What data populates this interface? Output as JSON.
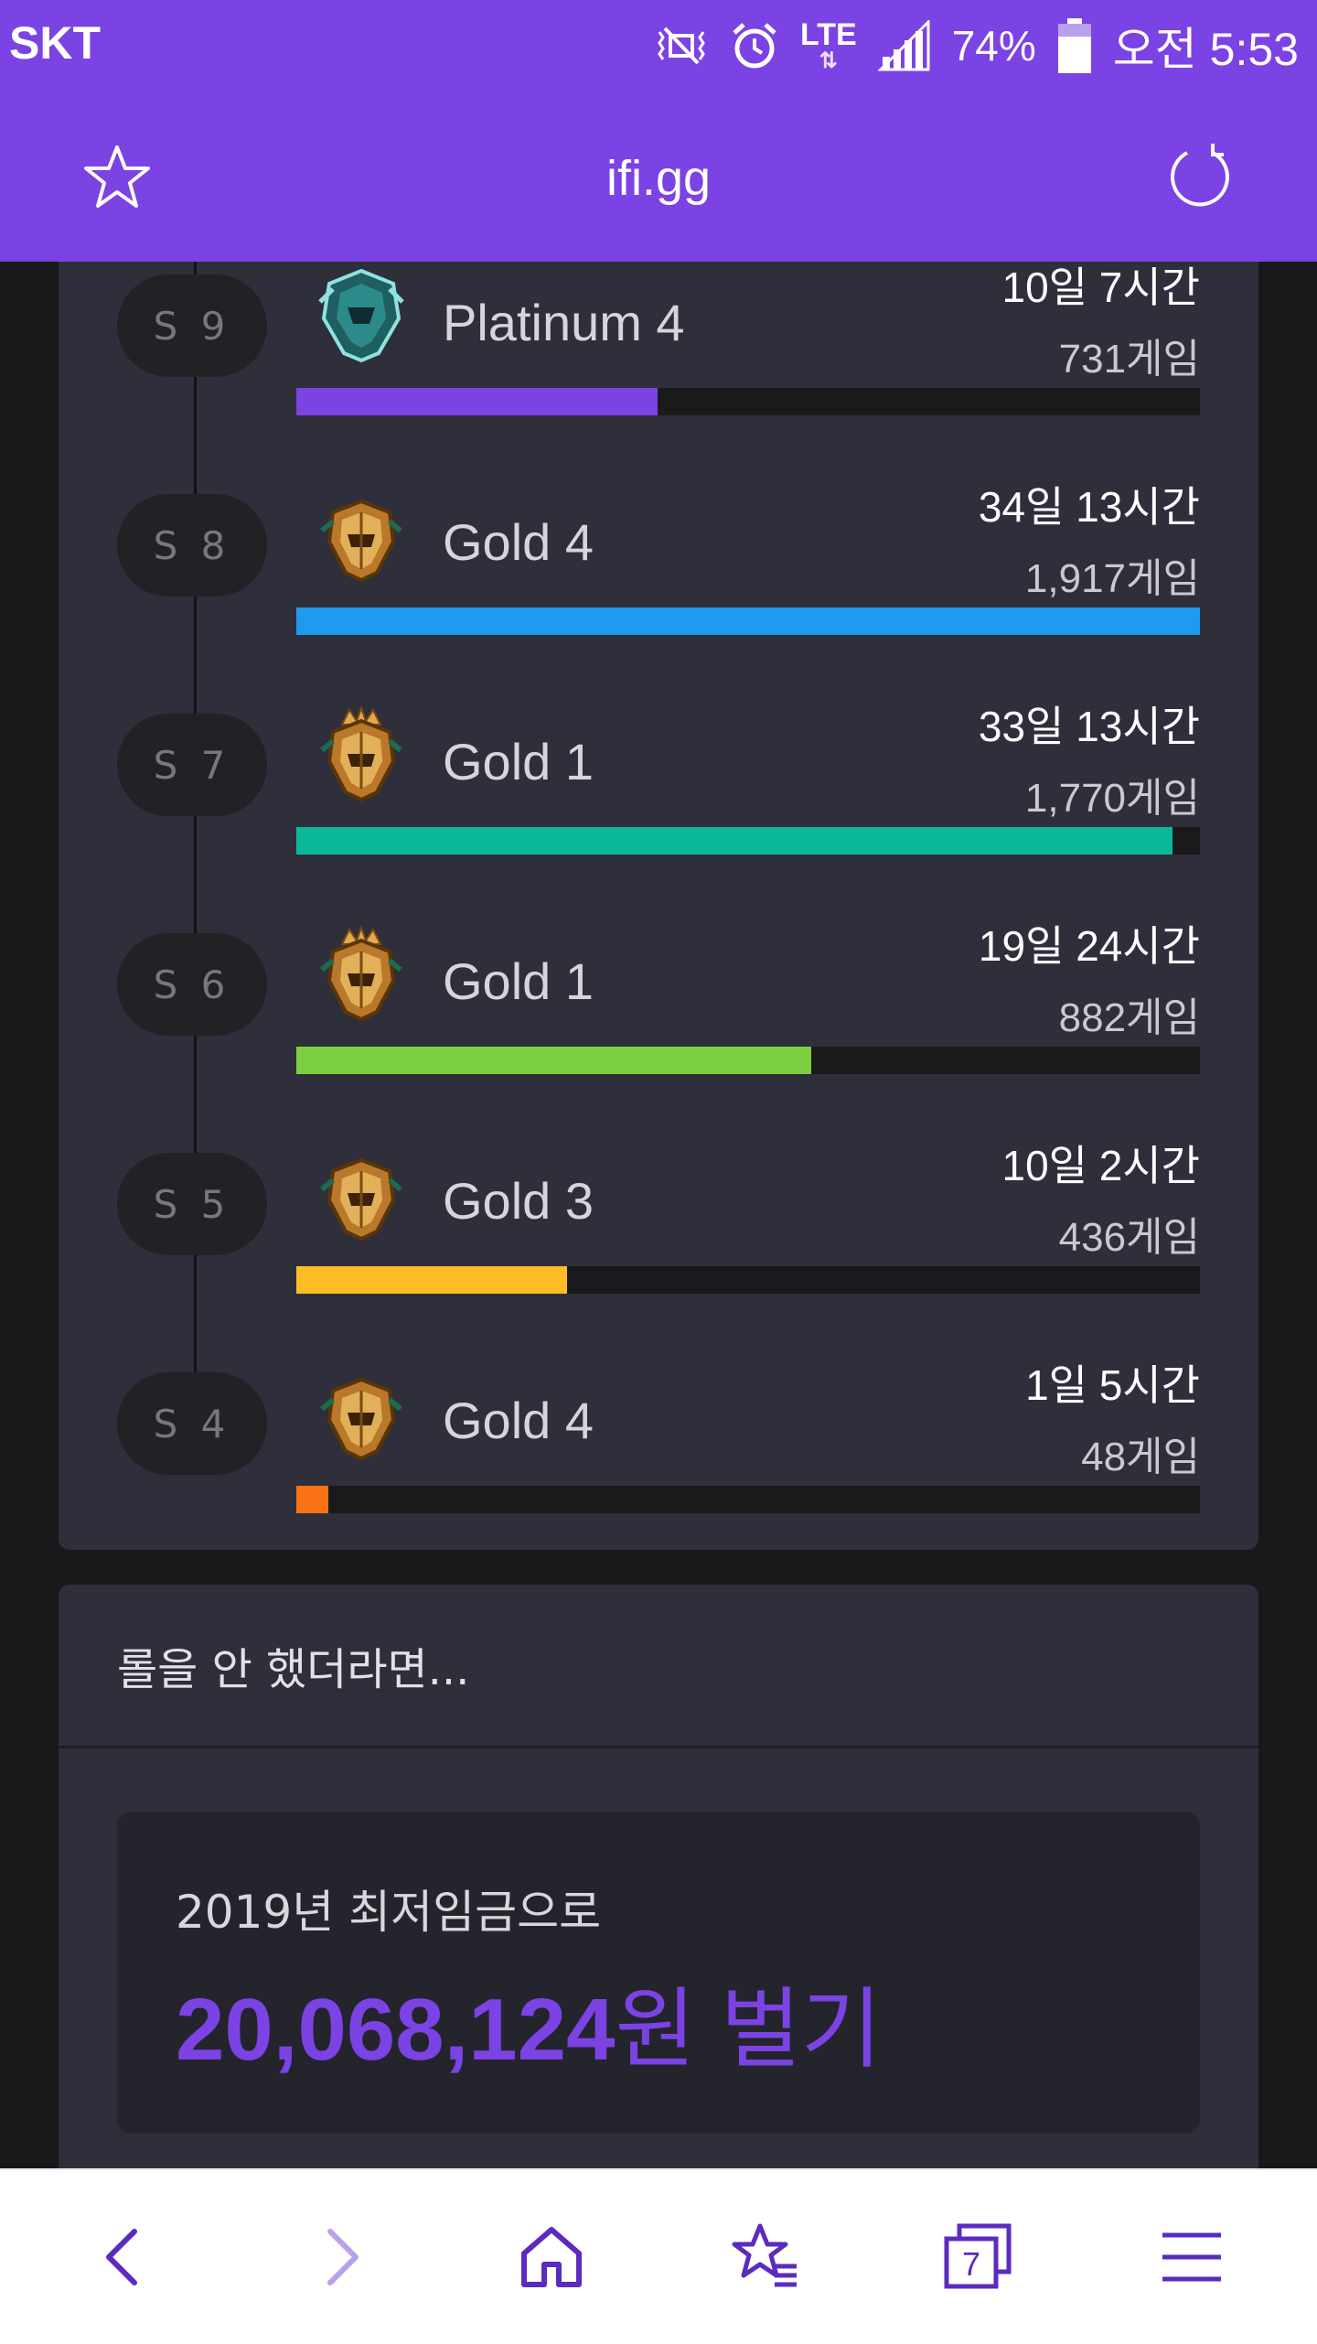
{
  "status_bar": {
    "carrier": "SKT",
    "network": "LTE",
    "battery": "74%",
    "time": "오전 5:53"
  },
  "browser": {
    "url": "ifi.gg",
    "tab_count": "7"
  },
  "seasons": [
    {
      "season": "S 9",
      "tier": "Platinum 4",
      "playtime": "10일 7시간",
      "games": "731게임",
      "bar_fraction": 0.4,
      "bar_color": "#7b42e4",
      "emblem": "platinum"
    },
    {
      "season": "S 8",
      "tier": "Gold 4",
      "playtime": "34일 13시간",
      "games": "1,917게임",
      "bar_fraction": 1.0,
      "bar_color": "#1e9bf0",
      "emblem": "gold"
    },
    {
      "season": "S 7",
      "tier": "Gold 1",
      "playtime": "33일 13시간",
      "games": "1,770게임",
      "bar_fraction": 0.97,
      "bar_color": "#0ab99a",
      "emblem": "gold-crown"
    },
    {
      "season": "S 6",
      "tier": "Gold 1",
      "playtime": "19일 24시간",
      "games": "882게임",
      "bar_fraction": 0.57,
      "bar_color": "#7dcf42",
      "emblem": "gold-crown"
    },
    {
      "season": "S 5",
      "tier": "Gold 3",
      "playtime": "10일 2시간",
      "games": "436게임",
      "bar_fraction": 0.3,
      "bar_color": "#fbbd23",
      "emblem": "gold"
    },
    {
      "season": "S 4",
      "tier": "Gold 4",
      "playtime": "1일 5시간",
      "games": "48게임",
      "bar_fraction": 0.035,
      "bar_color": "#f97316",
      "emblem": "gold"
    }
  ],
  "income": {
    "header": "롤을 안 했더라면...",
    "label": "2019년 최저임금으로",
    "amount": "20,068,124",
    "suffix": "원 벌기"
  },
  "icons": {
    "status": [
      "mute-icon",
      "alarm-icon",
      "signal-icon",
      "battery-icon"
    ],
    "nav": [
      "back-icon",
      "forward-icon",
      "home-icon",
      "bookmarks-icon",
      "tabs-icon",
      "menu-icon"
    ]
  },
  "accent_color": "#7b42e4"
}
